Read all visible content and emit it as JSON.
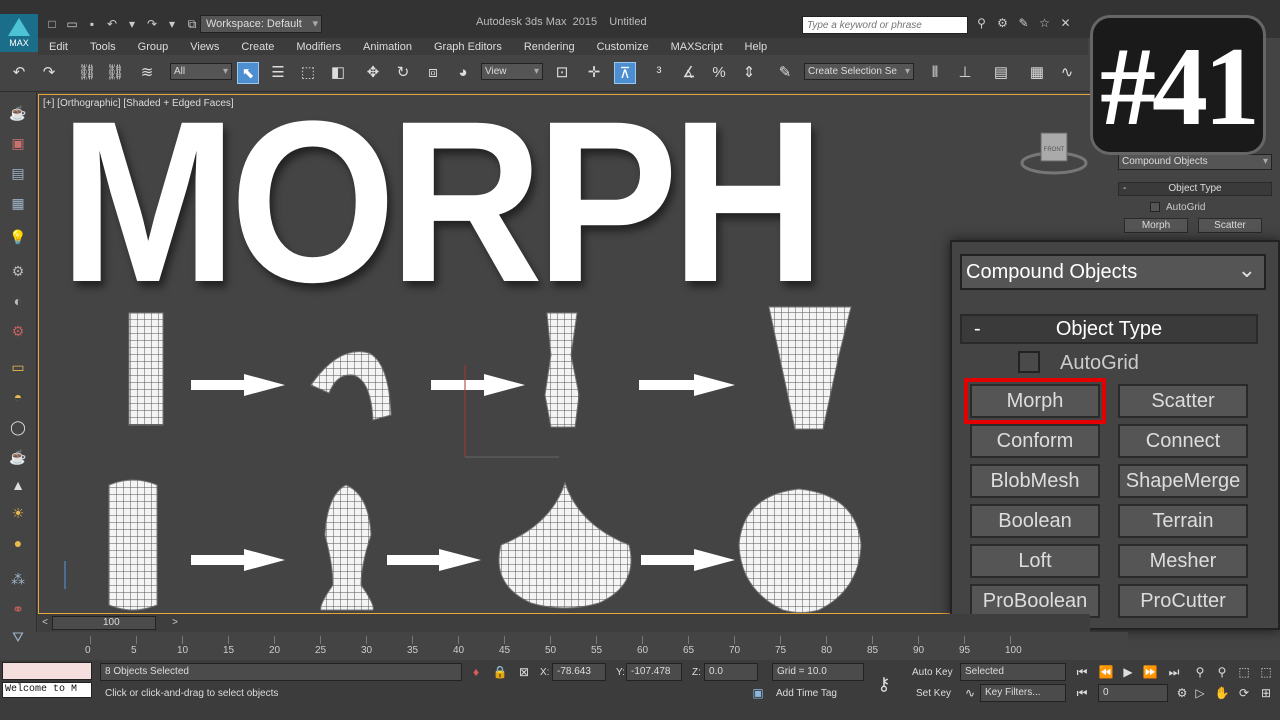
{
  "titlebar": {
    "logo_label": "MAX",
    "workspace": "Workspace: Default",
    "app_title": "Autodesk 3ds Max  2015    Untitled",
    "search_placeholder": "Type a keyword or phrase"
  },
  "menu": [
    "Edit",
    "Tools",
    "Group",
    "Views",
    "Create",
    "Modifiers",
    "Animation",
    "Graph Editors",
    "Rendering",
    "Customize",
    "MAXScript",
    "Help"
  ],
  "toolbar": {
    "selection_filter": "All",
    "ref_coord": "View",
    "named_selection": "Create Selection Se"
  },
  "viewport": {
    "label": "[+] [Orthographic] [Shaded + Edged Faces]",
    "title_overlay": "MORPH",
    "cube_label": "FRONT"
  },
  "badge": "#41",
  "command_panel": {
    "category": "Compound Objects",
    "rollout": "Object Type",
    "autogrid": "AutoGrid",
    "buttons": [
      "Morph",
      "Scatter"
    ]
  },
  "zoom_panel": {
    "category": "Compound Objects",
    "rollout": "Object Type",
    "minus": "-",
    "autogrid": "AutoGrid",
    "buttons": [
      "Morph",
      "Scatter",
      "Conform",
      "Connect",
      "BlobMesh",
      "ShapeMerge",
      "Boolean",
      "Terrain",
      "Loft",
      "Mesher",
      "ProBoolean",
      "ProCutter"
    ],
    "highlighted": "Morph"
  },
  "timeline": {
    "frame": "100",
    "ticks": [
      "0",
      "5",
      "10",
      "15",
      "20",
      "25",
      "30",
      "35",
      "40",
      "45",
      "50",
      "55",
      "60",
      "65",
      "70",
      "75",
      "80",
      "85",
      "90",
      "95",
      "100"
    ]
  },
  "status": {
    "selected": "8 Objects Selected",
    "prompt": "Click or click-and-drag to select objects",
    "welcome": "Welcome to M",
    "x_label": "X:",
    "x": "-78.643",
    "y_label": "Y:",
    "y": "-107.478",
    "z_label": "Z:",
    "z": "0.0",
    "grid": "Grid = 10.0",
    "add_time_tag": "Add Time Tag",
    "auto_key": "Auto Key",
    "set_key": "Set Key",
    "key_mode": "Selected",
    "key_filters": "Key Filters...",
    "current_frame": "0"
  }
}
